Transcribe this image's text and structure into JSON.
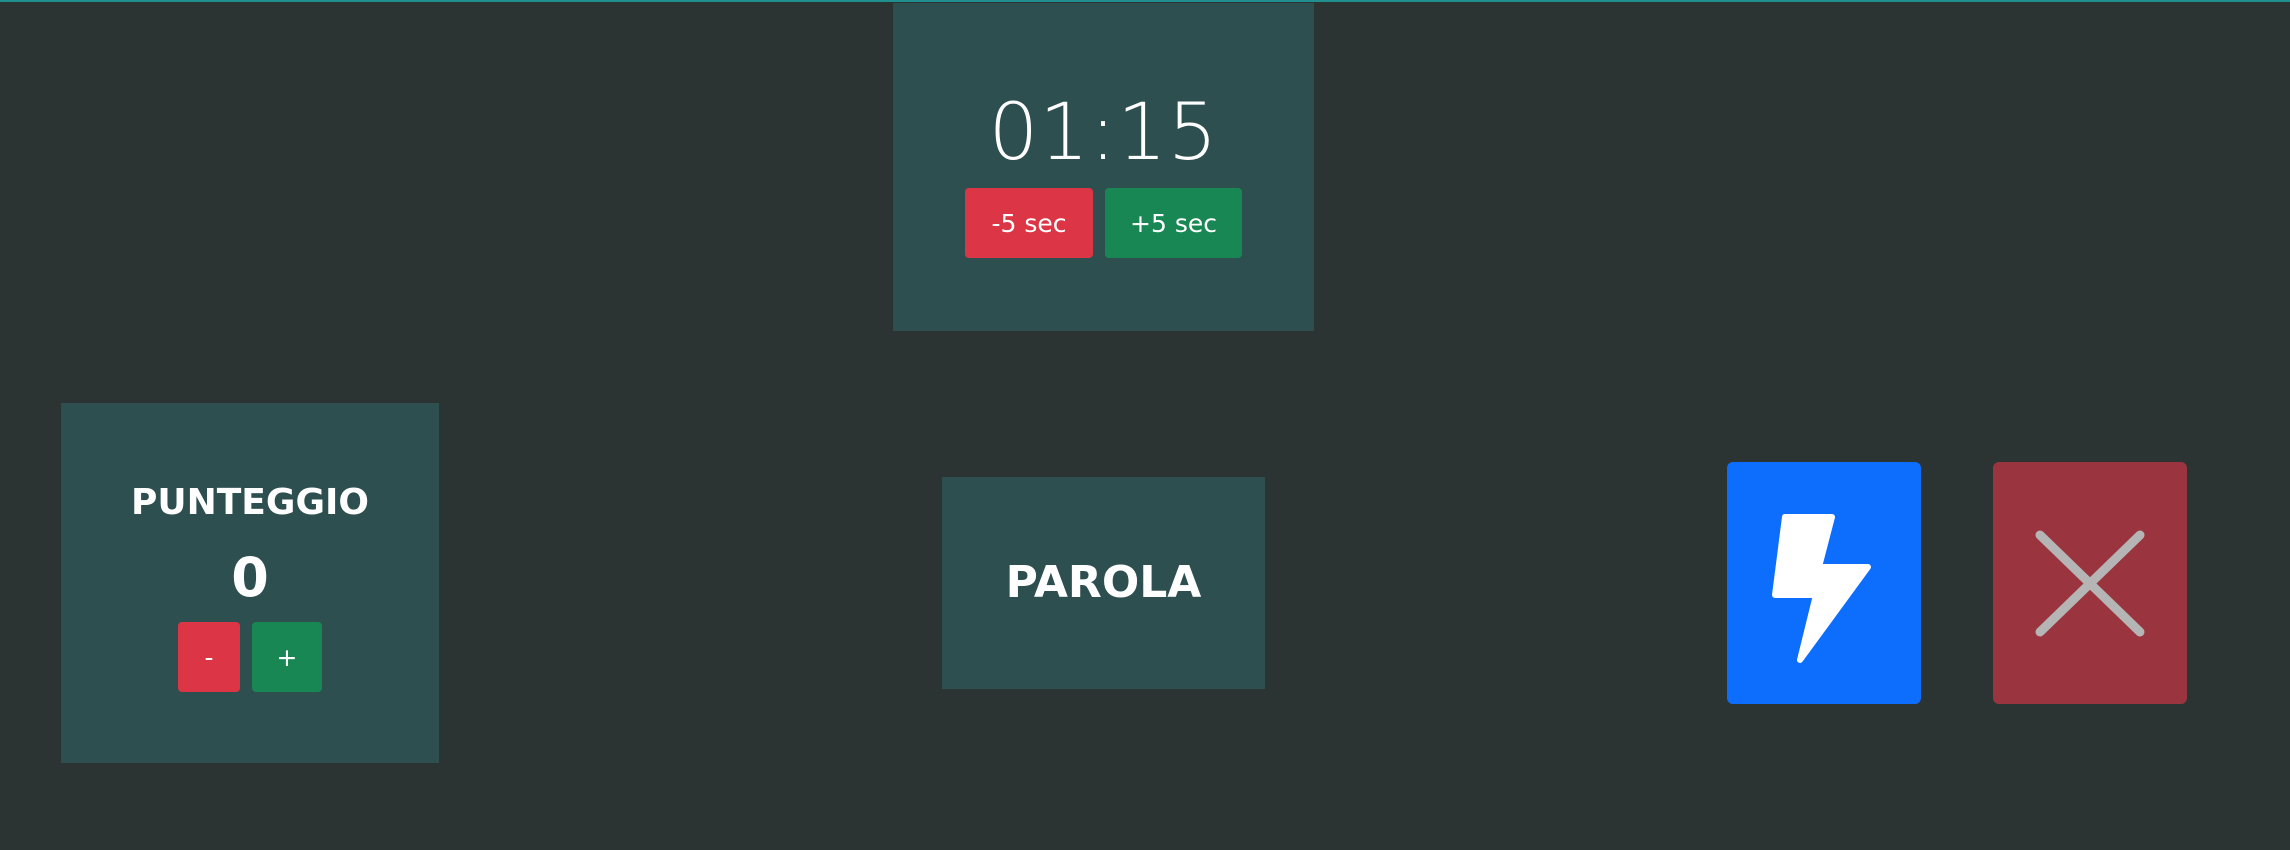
{
  "timer": {
    "display": "01:15",
    "minus_label": "-5 sec",
    "plus_label": "+5 sec"
  },
  "score": {
    "label": "PUNTEGGIO",
    "value": "0",
    "minus_label": "-",
    "plus_label": "+"
  },
  "word": {
    "text": "PAROLA"
  },
  "actions": {
    "correct_icon": "lightning-bolt-icon",
    "skip_icon": "close-x-icon"
  },
  "colors": {
    "background": "#2c3333",
    "panel": "#2e4f4f",
    "danger": "#dc3545",
    "success": "#198754",
    "primary": "#0d6efd",
    "skip": "#9a3540"
  }
}
